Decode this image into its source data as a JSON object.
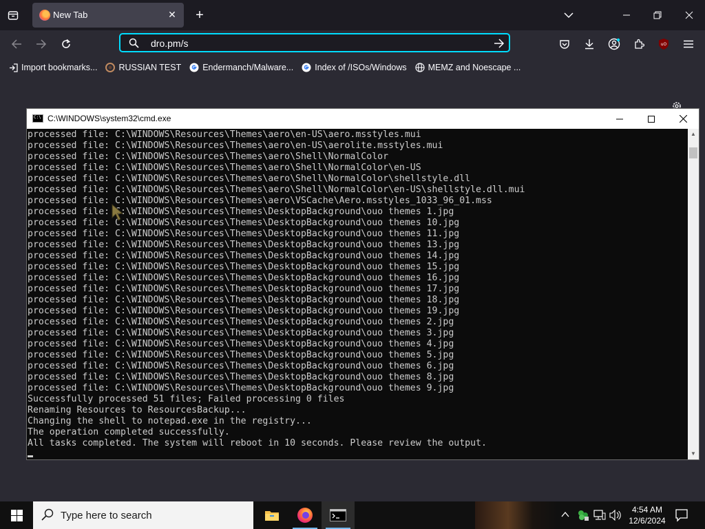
{
  "browser": {
    "tab": {
      "title": "New Tab"
    },
    "address": {
      "url": "dro.pm/s"
    },
    "bookmarks": [
      {
        "label": "Import bookmarks...",
        "icon": "import-icon"
      },
      {
        "label": "RUSSIAN TEST",
        "icon": "site-icon"
      },
      {
        "label": "Endermanch/Malware...",
        "icon": "google-icon"
      },
      {
        "label": "Index of /ISOs/Windows",
        "icon": "google-icon"
      },
      {
        "label": "MEMZ and Noescape ...",
        "icon": "globe-icon"
      }
    ],
    "accent_color": "#00ddff"
  },
  "cmd": {
    "title": "C:\\WINDOWS\\system32\\cmd.exe",
    "lines": [
      "processed file: C:\\WINDOWS\\Resources\\Themes\\aero\\en-US\\aero.msstyles.mui",
      "processed file: C:\\WINDOWS\\Resources\\Themes\\aero\\en-US\\aerolite.msstyles.mui",
      "processed file: C:\\WINDOWS\\Resources\\Themes\\aero\\Shell\\NormalColor",
      "processed file: C:\\WINDOWS\\Resources\\Themes\\aero\\Shell\\NormalColor\\en-US",
      "processed file: C:\\WINDOWS\\Resources\\Themes\\aero\\Shell\\NormalColor\\shellstyle.dll",
      "processed file: C:\\WINDOWS\\Resources\\Themes\\aero\\Shell\\NormalColor\\en-US\\shellstyle.dll.mui",
      "processed file: C:\\WINDOWS\\Resources\\Themes\\aero\\VSCache\\Aero.msstyles_1033_96_01.mss",
      "processed file: C:\\WINDOWS\\Resources\\Themes\\DesktopBackground\\ouo themes 1.jpg",
      "processed file: C:\\WINDOWS\\Resources\\Themes\\DesktopBackground\\ouo themes 10.jpg",
      "processed file: C:\\WINDOWS\\Resources\\Themes\\DesktopBackground\\ouo themes 11.jpg",
      "processed file: C:\\WINDOWS\\Resources\\Themes\\DesktopBackground\\ouo themes 13.jpg",
      "processed file: C:\\WINDOWS\\Resources\\Themes\\DesktopBackground\\ouo themes 14.jpg",
      "processed file: C:\\WINDOWS\\Resources\\Themes\\DesktopBackground\\ouo themes 15.jpg",
      "processed file: C:\\WINDOWS\\Resources\\Themes\\DesktopBackground\\ouo themes 16.jpg",
      "processed file: C:\\WINDOWS\\Resources\\Themes\\DesktopBackground\\ouo themes 17.jpg",
      "processed file: C:\\WINDOWS\\Resources\\Themes\\DesktopBackground\\ouo themes 18.jpg",
      "processed file: C:\\WINDOWS\\Resources\\Themes\\DesktopBackground\\ouo themes 19.jpg",
      "processed file: C:\\WINDOWS\\Resources\\Themes\\DesktopBackground\\ouo themes 2.jpg",
      "processed file: C:\\WINDOWS\\Resources\\Themes\\DesktopBackground\\ouo themes 3.jpg",
      "processed file: C:\\WINDOWS\\Resources\\Themes\\DesktopBackground\\ouo themes 4.jpg",
      "processed file: C:\\WINDOWS\\Resources\\Themes\\DesktopBackground\\ouo themes 5.jpg",
      "processed file: C:\\WINDOWS\\Resources\\Themes\\DesktopBackground\\ouo themes 6.jpg",
      "processed file: C:\\WINDOWS\\Resources\\Themes\\DesktopBackground\\ouo themes 8.jpg",
      "processed file: C:\\WINDOWS\\Resources\\Themes\\DesktopBackground\\ouo themes 9.jpg",
      "Successfully processed 51 files; Failed processing 0 files",
      "Renaming Resources to ResourcesBackup...",
      "Changing the shell to notepad.exe in the registry...",
      "The operation completed successfully.",
      "All tasks completed. The system will reboot in 10 seconds. Please review the output."
    ]
  },
  "taskbar": {
    "search_placeholder": "Type here to search",
    "apps": [
      {
        "name": "file-explorer",
        "icon": "folder-icon"
      },
      {
        "name": "firefox",
        "icon": "firefox-icon"
      },
      {
        "name": "command-prompt",
        "icon": "terminal-icon"
      }
    ],
    "time": "4:54 AM",
    "date": "12/6/2024"
  }
}
